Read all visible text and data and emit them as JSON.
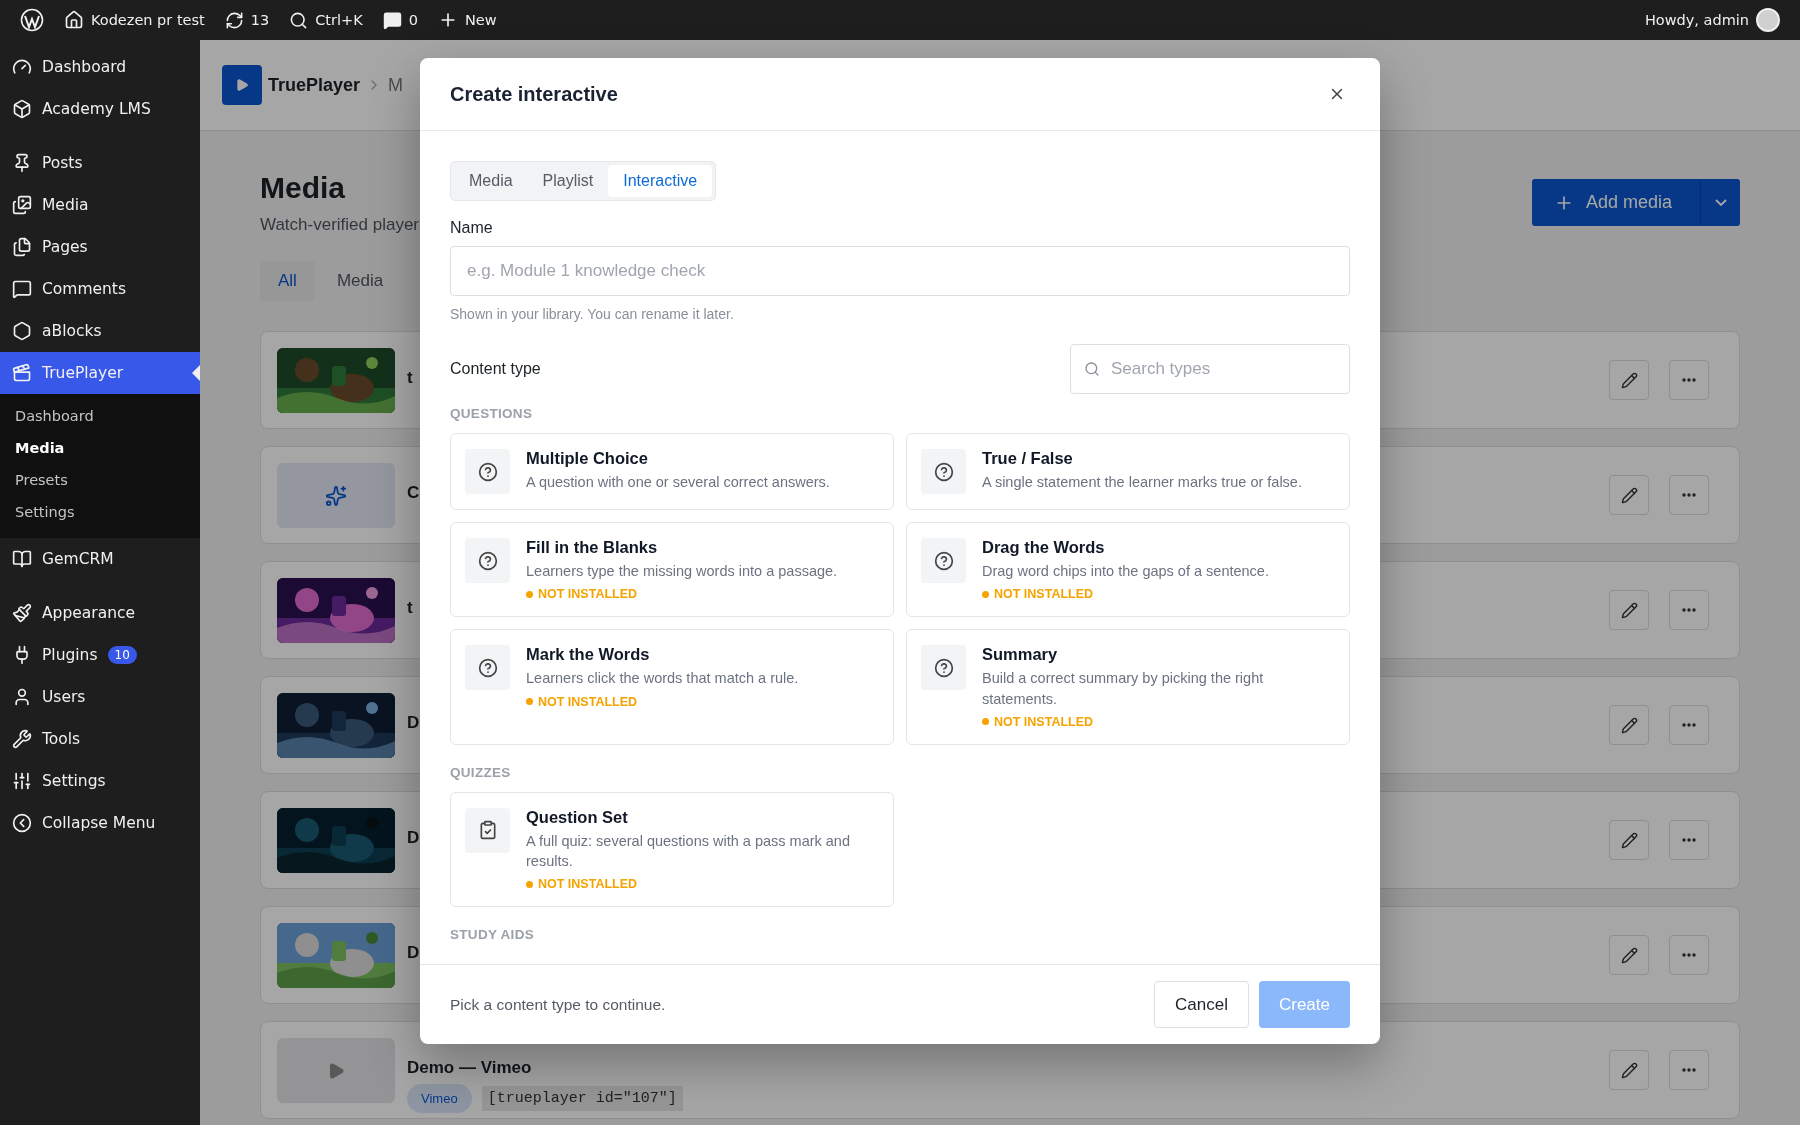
{
  "admin_bar": {
    "site": "Kodezen pr test",
    "updates": "13",
    "search": "Ctrl+K",
    "comments": "0",
    "new": "New",
    "greeting": "Howdy, admin"
  },
  "sidebar": {
    "groups": [
      [
        {
          "label": "Dashboard",
          "selected": false
        },
        {
          "label": "Academy LMS",
          "selected": false
        }
      ],
      [
        {
          "label": "Posts",
          "selected": false
        },
        {
          "label": "Media",
          "selected": false
        },
        {
          "label": "Pages",
          "selected": false
        },
        {
          "label": "Comments",
          "selected": false
        },
        {
          "label": "aBlocks",
          "selected": false
        },
        {
          "label": "TruePlayer",
          "selected": true,
          "children": [
            {
              "label": "Dashboard",
              "selected": false
            },
            {
              "label": "Media",
              "selected": true
            },
            {
              "label": "Presets",
              "selected": false
            },
            {
              "label": "Settings",
              "selected": false
            }
          ]
        },
        {
          "label": "GemCRM",
          "selected": false
        }
      ],
      [
        {
          "label": "Appearance",
          "selected": false
        },
        {
          "label": "Plugins",
          "selected": false,
          "badge": "10"
        },
        {
          "label": "Users",
          "selected": false
        },
        {
          "label": "Tools",
          "selected": false
        },
        {
          "label": "Settings",
          "selected": false
        },
        {
          "label": "Collapse Menu",
          "selected": false
        }
      ]
    ]
  },
  "page": {
    "breadcrumb": [
      "TruePlayer",
      "M"
    ],
    "title": "Media",
    "subtitle": "Watch-verified player",
    "tabs": [
      {
        "label": "All",
        "selected": true
      },
      {
        "label": "Media",
        "selected": false
      }
    ],
    "add_button": "Add media",
    "rows": [
      {
        "title": "t",
        "kind": "picture"
      },
      {
        "title": "C",
        "kind": "generated"
      },
      {
        "title": "t",
        "kind": "picture"
      },
      {
        "title": "D",
        "kind": "picture"
      },
      {
        "title": "D",
        "kind": "picture"
      },
      {
        "title": "D",
        "kind": "picture"
      },
      {
        "title": "Demo — Vimeo",
        "kind": "empty",
        "badge": "Vimeo",
        "shortcode": "[trueplayer id=\"107\"]"
      }
    ]
  },
  "modal": {
    "title": "Create interactive",
    "tabs": [
      {
        "label": "Media",
        "selected": false
      },
      {
        "label": "Playlist",
        "selected": false
      },
      {
        "label": "Interactive",
        "selected": true
      }
    ],
    "name_label": "Name",
    "name_placeholder": "e.g. Module 1 knowledge check",
    "name_help": "Shown in your library. You can rename it later.",
    "content_type_label": "Content type",
    "search_placeholder": "Search types",
    "sections": [
      {
        "heading": "QUESTIONS",
        "kind": "question",
        "items": [
          {
            "title": "Multiple Choice",
            "description": "A question with one or several correct answers."
          },
          {
            "title": "True / False",
            "description": "A single statement the learner marks true or false."
          },
          {
            "title": "Fill in the Blanks",
            "description": "Learners type the missing words into a passage.",
            "status": "NOT INSTALLED"
          },
          {
            "title": "Drag the Words",
            "description": "Drag word chips into the gaps of a sentence.",
            "status": "NOT INSTALLED"
          },
          {
            "title": "Mark the Words",
            "description": "Learners click the words that match a rule.",
            "status": "NOT INSTALLED"
          },
          {
            "title": "Summary",
            "description": "Build a correct summary by picking the right statements.",
            "status": "NOT INSTALLED"
          }
        ]
      },
      {
        "heading": "QUIZZES",
        "kind": "quiz",
        "items": [
          {
            "title": "Question Set",
            "description": "A full quiz: several questions with a pass mark and results.",
            "status": "NOT INSTALLED"
          }
        ]
      },
      {
        "heading": "STUDY AIDS"
      }
    ],
    "footer_hint": "Pick a content type to continue.",
    "cancel": "Cancel",
    "create": {
      "label": "Create",
      "disabled": true
    }
  }
}
